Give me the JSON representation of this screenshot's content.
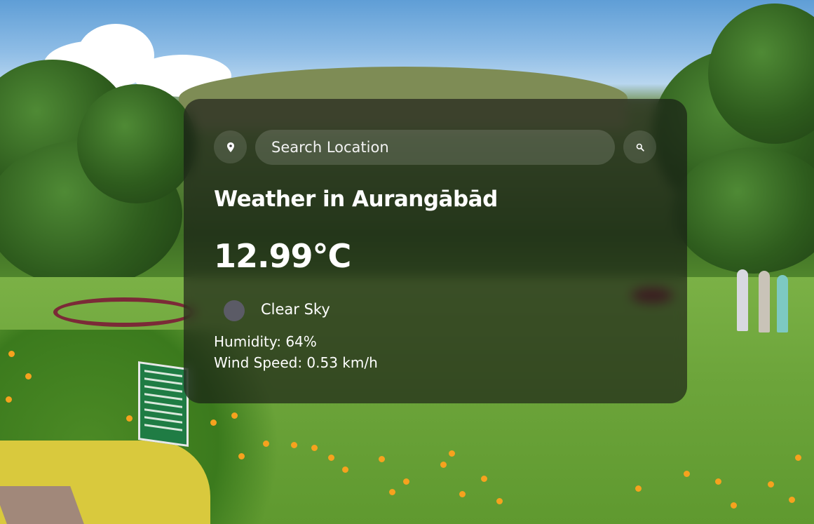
{
  "search": {
    "placeholder": "Search Location"
  },
  "weather": {
    "title": "Weather in Aurangābād",
    "temperature": "12.99°C",
    "condition": "Clear Sky",
    "humidity": "Humidity: 64%",
    "wind_speed": "Wind Speed: 0.53 km/h"
  },
  "icons": {
    "location": "location-pin-icon",
    "search": "search-icon",
    "condition": "weather-condition-icon"
  },
  "colors": {
    "card_background": "#141414",
    "text": "#ffffff"
  }
}
